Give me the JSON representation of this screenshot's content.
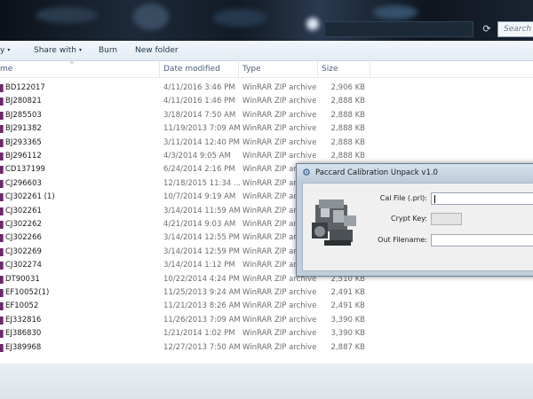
{
  "window": {
    "search_placeholder": "Search P"
  },
  "toolbar": {
    "items": [
      {
        "label": "y",
        "caret": "▾"
      },
      {
        "label": "Share with",
        "caret": "▾"
      },
      {
        "label": "Burn",
        "caret": ""
      },
      {
        "label": "New folder",
        "caret": ""
      }
    ]
  },
  "columns": {
    "name": "me",
    "date": "Date modified",
    "type": "Type",
    "size": "Size"
  },
  "files": [
    {
      "name": "BD122017",
      "date": "4/11/2016 3:46 PM",
      "type": "WinRAR ZIP archive",
      "size": "2,906 KB"
    },
    {
      "name": "BJ280821",
      "date": "4/11/2016 1:46 PM",
      "type": "WinRAR ZIP archive",
      "size": "2,888 KB"
    },
    {
      "name": "BJ285503",
      "date": "3/18/2014 7:50 AM",
      "type": "WinRAR ZIP archive",
      "size": "2,888 KB"
    },
    {
      "name": "BJ291382",
      "date": "11/19/2013 7:09 AM",
      "type": "WinRAR ZIP archive",
      "size": "2,888 KB"
    },
    {
      "name": "BJ293365",
      "date": "3/11/2014 12:40 PM",
      "type": "WinRAR ZIP archive",
      "size": "2,888 KB"
    },
    {
      "name": "BJ296112",
      "date": "4/3/2014 9:05 AM",
      "type": "WinRAR ZIP archive",
      "size": "2,888 KB"
    },
    {
      "name": "CD137199",
      "date": "6/24/2014 2:16 PM",
      "type": "WinRAR ZIP archive",
      "size": ""
    },
    {
      "name": "CJ296603",
      "date": "12/18/2015 11:34 ...",
      "type": "WinRAR ZIP archive",
      "size": ""
    },
    {
      "name": "CJ302261 (1)",
      "date": "10/7/2014 9:19 AM",
      "type": "WinRAR ZIP archive",
      "size": ""
    },
    {
      "name": "CJ302261",
      "date": "3/14/2014 11:59 AM",
      "type": "WinRAR ZIP archive",
      "size": ""
    },
    {
      "name": "CJ302262",
      "date": "4/21/2014 9:03 AM",
      "type": "WinRAR ZIP archive",
      "size": ""
    },
    {
      "name": "CJ302266",
      "date": "3/14/2014 12:55 PM",
      "type": "WinRAR ZIP archive",
      "size": ""
    },
    {
      "name": "CJ302269",
      "date": "3/14/2014 12:59 PM",
      "type": "WinRAR ZIP archive",
      "size": ""
    },
    {
      "name": "CJ302274",
      "date": "3/14/2014 1:12 PM",
      "type": "WinRAR ZIP archive",
      "size": ""
    },
    {
      "name": "DT90031",
      "date": "10/22/2014 4:24 PM",
      "type": "WinRAR ZIP archive",
      "size": "2,510 KB"
    },
    {
      "name": "EF10052(1)",
      "date": "11/25/2013 9:24 AM",
      "type": "WinRAR ZIP archive",
      "size": "2,491 KB"
    },
    {
      "name": "EF10052",
      "date": "11/21/2013 8:26 AM",
      "type": "WinRAR ZIP archive",
      "size": "2,491 KB"
    },
    {
      "name": "EJ332816",
      "date": "11/26/2013 7:09 AM",
      "type": "WinRAR ZIP archive",
      "size": "3,390 KB"
    },
    {
      "name": "EJ386830",
      "date": "1/21/2014 1:02 PM",
      "type": "WinRAR ZIP archive",
      "size": "3,390 KB"
    },
    {
      "name": "EJ389968",
      "date": "12/27/2013 7:50 AM",
      "type": "WinRAR ZIP archive",
      "size": "2,887 KB"
    }
  ],
  "dialog": {
    "title": "Paccard Calibration Unpack v1.0",
    "cal_file_label": "Cal File (.prl):",
    "cal_file_value": "",
    "crypt_key_label": "Crypt Key:",
    "crypt_key_value": "",
    "out_filename_label": "Out Filename:",
    "out_filename_value": ""
  },
  "icons": {
    "file": "winrar-archive-icon",
    "dialog": "gear-icon",
    "refresh": "refresh-icon",
    "engine": "engine-image"
  }
}
